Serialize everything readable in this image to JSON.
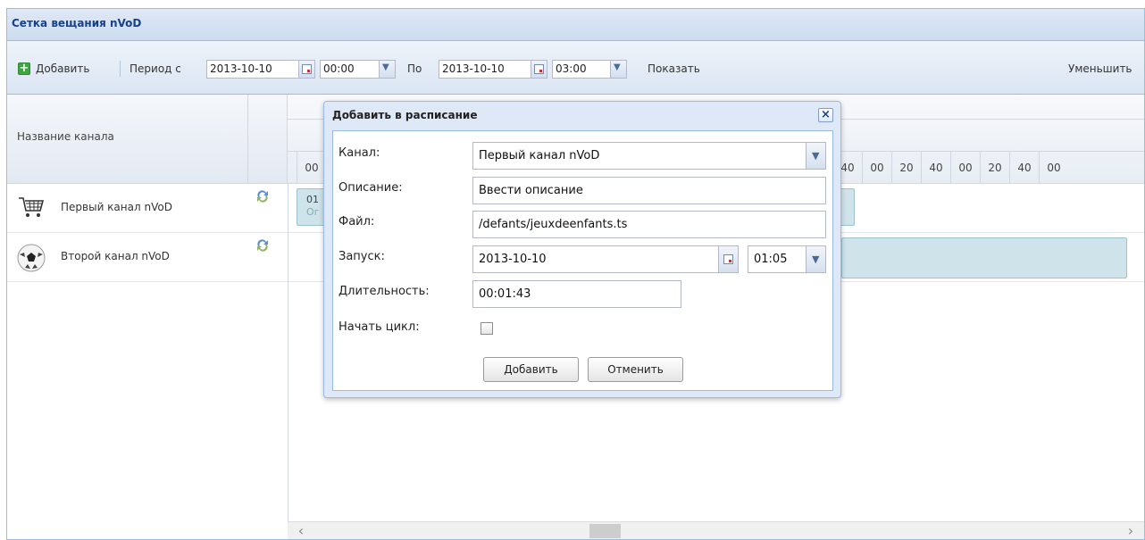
{
  "panel": {
    "title": "Сетка вещания nVoD"
  },
  "toolbar": {
    "add_label": "Добавить",
    "period_from_label": "Период с",
    "from_date": "2013-10-10",
    "from_time": "00:00",
    "to_label": "По",
    "to_date": "2013-10-10",
    "to_time": "03:00",
    "show_label": "Показать",
    "zoom_out_label": "Уменьшить"
  },
  "grid": {
    "channel_col_header": "Название канала",
    "ticks": [
      "00",
      "40",
      "00",
      "20",
      "40",
      "00",
      "20",
      "40",
      "00"
    ],
    "channels": [
      {
        "name": "Первый канал nVoD",
        "icon": "cart-icon"
      },
      {
        "name": "Второй канал nVoD",
        "icon": "soccer-ball-icon"
      }
    ],
    "event_partial_1": "01",
    "event_partial_2": "Ог"
  },
  "dialog": {
    "title": "Добавить в расписание",
    "channel_label": "Канал:",
    "channel_value": "Первый канал nVoD",
    "description_label": "Описание:",
    "description_value": "Ввести описание",
    "file_label": "Файл:",
    "file_value": "/defants/jeuxdeenfants.ts",
    "start_label": "Запуск:",
    "start_date": "2013-10-10",
    "start_time": "01:05",
    "duration_label": "Длительность:",
    "duration_value": "00:01:43",
    "loop_label": "Начать цикл:",
    "add_button": "Добавить",
    "cancel_button": "Отменить"
  }
}
